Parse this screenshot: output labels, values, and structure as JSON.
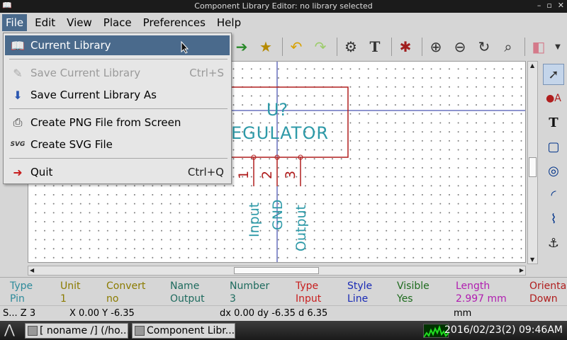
{
  "window": {
    "title": "Component Library Editor: no library selected",
    "min": "–",
    "max": "▫",
    "close": "✕"
  },
  "menubar": [
    "File",
    "Edit",
    "View",
    "Place",
    "Preferences",
    "Help"
  ],
  "file_menu": {
    "items": [
      {
        "label": "Current Library",
        "shortcut": "",
        "icon": "library-book-icon",
        "state": "highlighted"
      },
      {
        "label": "Save Current Library",
        "shortcut": "Ctrl+S",
        "icon": "save-icon",
        "state": "disabled"
      },
      {
        "label": "Save Current Library As",
        "shortcut": "",
        "icon": "save-as-icon",
        "state": "normal"
      },
      {
        "label": "Create PNG File from Screen",
        "shortcut": "",
        "icon": "printer-icon",
        "state": "normal"
      },
      {
        "label": "Create SVG File",
        "shortcut": "",
        "icon": "svg-icon",
        "state": "normal"
      },
      {
        "label": "Quit",
        "shortcut": "Ctrl+Q",
        "icon": "quit-icon",
        "state": "normal"
      }
    ],
    "svg_badge": "SVG"
  },
  "canvas": {
    "ref": "U?",
    "value": "EGULATOR",
    "pins": [
      {
        "number": "1",
        "name": "Input"
      },
      {
        "number": "2",
        "name": "GND"
      },
      {
        "number": "3",
        "name": "Output"
      }
    ]
  },
  "info_panel": {
    "fields": [
      {
        "label": "Type",
        "value": "Pin",
        "color": "#2e8b9b"
      },
      {
        "label": "Unit",
        "value": "1",
        "color": "#8b7b00"
      },
      {
        "label": "Convert",
        "value": "no",
        "color": "#8b7b00"
      },
      {
        "label": "Name",
        "value": "Output",
        "color": "#1e6b5e"
      },
      {
        "label": "Number",
        "value": "3",
        "color": "#1e6b5e"
      },
      {
        "label": "Type",
        "value": "Input",
        "color": "#c81e1e"
      },
      {
        "label": "Style",
        "value": "Line",
        "color": "#1a2bb5"
      },
      {
        "label": "Visible",
        "value": "Yes",
        "color": "#1e6b1e"
      },
      {
        "label": "Length",
        "value": "2.997 mm",
        "color": "#b01eb0"
      },
      {
        "label": "Orienta",
        "value": "Down",
        "color": "#b01e1e"
      }
    ]
  },
  "status": {
    "zoom": "S... Z 3",
    "xy": "X 0.00  Y -6.35",
    "delta": "dx 0.00  dy -6.35  d 6.35",
    "units": "mm"
  },
  "taskbar": {
    "tasks": [
      "[ noname /] (/ho...",
      "Component Libr..."
    ],
    "clock": "2016/02/23(2) 09:46AM"
  }
}
